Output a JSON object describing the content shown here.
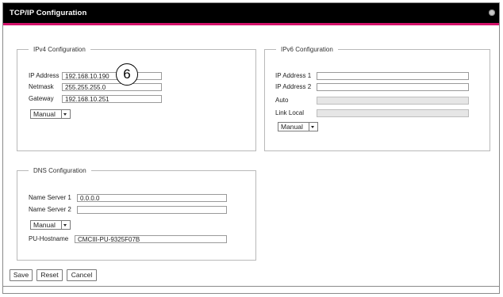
{
  "window": {
    "title": "TCP/IP Configuration"
  },
  "ipv4": {
    "legend": "IPv4 Configuration",
    "ip_label": "IP Address",
    "ip_value": "192.168.10.190",
    "netmask_label": "Netmask",
    "netmask_value": "255.255.255.0",
    "gateway_label": "Gateway",
    "gateway_value": "192.168.10.251",
    "mode": "Manual"
  },
  "ipv6": {
    "legend": "IPv6 Configuration",
    "ip1_label": "IP Address 1",
    "ip1_value": "",
    "ip2_label": "IP Address 2",
    "ip2_value": "",
    "auto_label": "Auto",
    "auto_value": "",
    "linklocal_label": "Link Local",
    "linklocal_value": "",
    "mode": "Manual"
  },
  "dns": {
    "legend": "DNS Configuration",
    "ns1_label": "Name Server 1",
    "ns1_value": "0.0.0.0",
    "ns2_label": "Name Server 2",
    "ns2_value": "",
    "mode": "Manual",
    "hostname_label": "PU-Hostname",
    "hostname_value": "CMCIII-PU-9325F07B"
  },
  "buttons": {
    "save": "Save",
    "reset": "Reset",
    "cancel": "Cancel"
  },
  "callout": "6",
  "colors": {
    "titlebar": "#000000",
    "accent": "#d4136b"
  },
  "icons": {
    "close": "close-icon",
    "dropdown": "chevron-down-icon"
  }
}
